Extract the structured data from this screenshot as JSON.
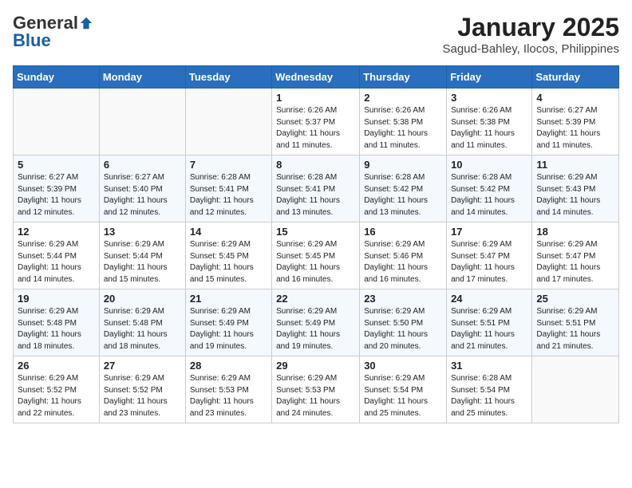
{
  "header": {
    "logo_general": "General",
    "logo_blue": "Blue",
    "month_year": "January 2025",
    "location": "Sagud-Bahley, Ilocos, Philippines"
  },
  "weekdays": [
    "Sunday",
    "Monday",
    "Tuesday",
    "Wednesday",
    "Thursday",
    "Friday",
    "Saturday"
  ],
  "weeks": [
    [
      {
        "day": "",
        "info": ""
      },
      {
        "day": "",
        "info": ""
      },
      {
        "day": "",
        "info": ""
      },
      {
        "day": "1",
        "info": "Sunrise: 6:26 AM\nSunset: 5:37 PM\nDaylight: 11 hours and 11 minutes."
      },
      {
        "day": "2",
        "info": "Sunrise: 6:26 AM\nSunset: 5:38 PM\nDaylight: 11 hours and 11 minutes."
      },
      {
        "day": "3",
        "info": "Sunrise: 6:26 AM\nSunset: 5:38 PM\nDaylight: 11 hours and 11 minutes."
      },
      {
        "day": "4",
        "info": "Sunrise: 6:27 AM\nSunset: 5:39 PM\nDaylight: 11 hours and 11 minutes."
      }
    ],
    [
      {
        "day": "5",
        "info": "Sunrise: 6:27 AM\nSunset: 5:39 PM\nDaylight: 11 hours and 12 minutes."
      },
      {
        "day": "6",
        "info": "Sunrise: 6:27 AM\nSunset: 5:40 PM\nDaylight: 11 hours and 12 minutes."
      },
      {
        "day": "7",
        "info": "Sunrise: 6:28 AM\nSunset: 5:41 PM\nDaylight: 11 hours and 12 minutes."
      },
      {
        "day": "8",
        "info": "Sunrise: 6:28 AM\nSunset: 5:41 PM\nDaylight: 11 hours and 13 minutes."
      },
      {
        "day": "9",
        "info": "Sunrise: 6:28 AM\nSunset: 5:42 PM\nDaylight: 11 hours and 13 minutes."
      },
      {
        "day": "10",
        "info": "Sunrise: 6:28 AM\nSunset: 5:42 PM\nDaylight: 11 hours and 14 minutes."
      },
      {
        "day": "11",
        "info": "Sunrise: 6:29 AM\nSunset: 5:43 PM\nDaylight: 11 hours and 14 minutes."
      }
    ],
    [
      {
        "day": "12",
        "info": "Sunrise: 6:29 AM\nSunset: 5:44 PM\nDaylight: 11 hours and 14 minutes."
      },
      {
        "day": "13",
        "info": "Sunrise: 6:29 AM\nSunset: 5:44 PM\nDaylight: 11 hours and 15 minutes."
      },
      {
        "day": "14",
        "info": "Sunrise: 6:29 AM\nSunset: 5:45 PM\nDaylight: 11 hours and 15 minutes."
      },
      {
        "day": "15",
        "info": "Sunrise: 6:29 AM\nSunset: 5:45 PM\nDaylight: 11 hours and 16 minutes."
      },
      {
        "day": "16",
        "info": "Sunrise: 6:29 AM\nSunset: 5:46 PM\nDaylight: 11 hours and 16 minutes."
      },
      {
        "day": "17",
        "info": "Sunrise: 6:29 AM\nSunset: 5:47 PM\nDaylight: 11 hours and 17 minutes."
      },
      {
        "day": "18",
        "info": "Sunrise: 6:29 AM\nSunset: 5:47 PM\nDaylight: 11 hours and 17 minutes."
      }
    ],
    [
      {
        "day": "19",
        "info": "Sunrise: 6:29 AM\nSunset: 5:48 PM\nDaylight: 11 hours and 18 minutes."
      },
      {
        "day": "20",
        "info": "Sunrise: 6:29 AM\nSunset: 5:48 PM\nDaylight: 11 hours and 18 minutes."
      },
      {
        "day": "21",
        "info": "Sunrise: 6:29 AM\nSunset: 5:49 PM\nDaylight: 11 hours and 19 minutes."
      },
      {
        "day": "22",
        "info": "Sunrise: 6:29 AM\nSunset: 5:49 PM\nDaylight: 11 hours and 19 minutes."
      },
      {
        "day": "23",
        "info": "Sunrise: 6:29 AM\nSunset: 5:50 PM\nDaylight: 11 hours and 20 minutes."
      },
      {
        "day": "24",
        "info": "Sunrise: 6:29 AM\nSunset: 5:51 PM\nDaylight: 11 hours and 21 minutes."
      },
      {
        "day": "25",
        "info": "Sunrise: 6:29 AM\nSunset: 5:51 PM\nDaylight: 11 hours and 21 minutes."
      }
    ],
    [
      {
        "day": "26",
        "info": "Sunrise: 6:29 AM\nSunset: 5:52 PM\nDaylight: 11 hours and 22 minutes."
      },
      {
        "day": "27",
        "info": "Sunrise: 6:29 AM\nSunset: 5:52 PM\nDaylight: 11 hours and 23 minutes."
      },
      {
        "day": "28",
        "info": "Sunrise: 6:29 AM\nSunset: 5:53 PM\nDaylight: 11 hours and 23 minutes."
      },
      {
        "day": "29",
        "info": "Sunrise: 6:29 AM\nSunset: 5:53 PM\nDaylight: 11 hours and 24 minutes."
      },
      {
        "day": "30",
        "info": "Sunrise: 6:29 AM\nSunset: 5:54 PM\nDaylight: 11 hours and 25 minutes."
      },
      {
        "day": "31",
        "info": "Sunrise: 6:28 AM\nSunset: 5:54 PM\nDaylight: 11 hours and 25 minutes."
      },
      {
        "day": "",
        "info": ""
      }
    ]
  ]
}
